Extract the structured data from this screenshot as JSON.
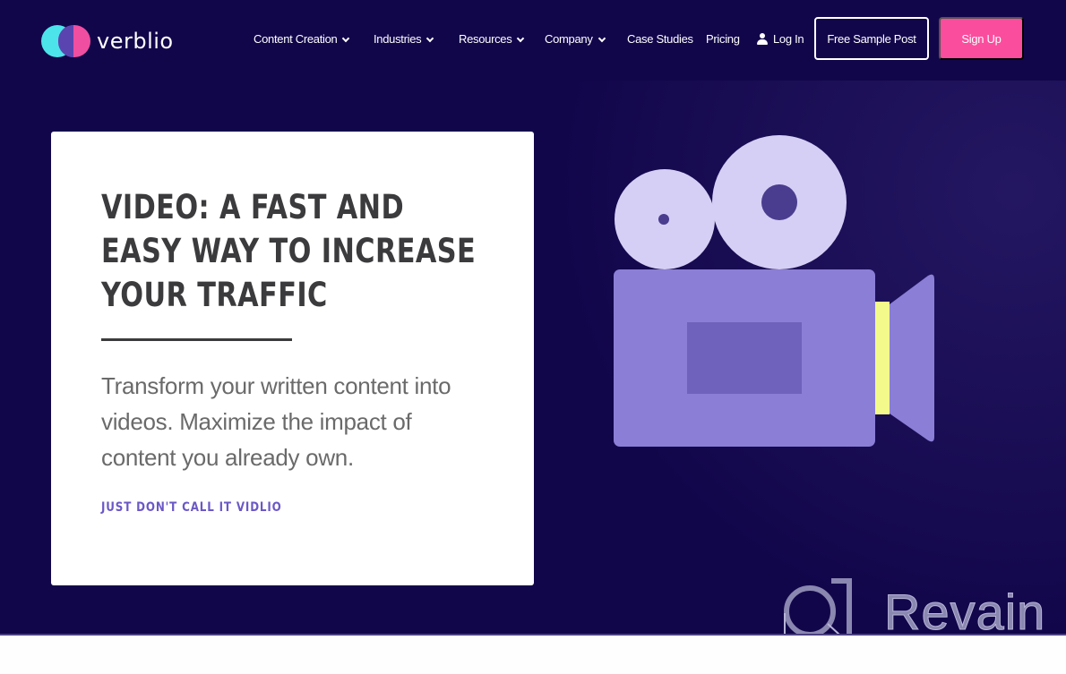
{
  "brand": {
    "name": "verblio",
    "colors": {
      "navy": "#12064b",
      "cyan": "#4de3ea",
      "pink": "#fb4d9d",
      "purple": "#6b58c6",
      "yellow": "#f3f98a",
      "lavender": "#c9c1f2"
    }
  },
  "nav": {
    "items": [
      {
        "label": "Content Creation",
        "has_dropdown": true
      },
      {
        "label": "Industries",
        "has_dropdown": true
      },
      {
        "label": "Resources",
        "has_dropdown": true
      },
      {
        "label": "Company",
        "has_dropdown": true
      },
      {
        "label": "Case Studies",
        "has_dropdown": false
      },
      {
        "label": "Pricing",
        "has_dropdown": false
      }
    ],
    "login": {
      "label": "Log In",
      "icon": "user-icon"
    },
    "sample_button": "Free Sample Post",
    "signup_button": "Sign Up"
  },
  "hero": {
    "title": "VIDEO: A FAST AND EASY WAY TO INCREASE YOUR TRAFFIC",
    "description": "Transform your written content into videos. Maximize the impact of content you already own.",
    "tagline_link": "JUST DON'T CALL IT VIDLIO",
    "illustration": "video-camera-icon"
  },
  "watermark": {
    "text": "Revain"
  }
}
